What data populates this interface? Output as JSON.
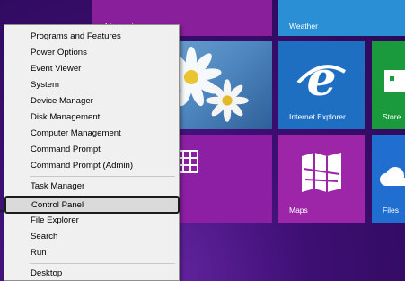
{
  "tiles": {
    "messaging_label": "Messaging",
    "weather_label": "Weather",
    "ie_label": "Internet Explorer",
    "store_label": "Store",
    "maps_label": "Maps",
    "files_label": "Files"
  },
  "menu": {
    "items": [
      "Programs and Features",
      "Power Options",
      "Event Viewer",
      "System",
      "Device Manager",
      "Disk Management",
      "Computer Management",
      "Command Prompt",
      "Command Prompt (Admin)",
      "Task Manager",
      "Control Panel",
      "File Explorer",
      "Search",
      "Run",
      "Desktop"
    ],
    "highlighted": "Control Panel"
  },
  "colors": {
    "start_background": "#3d0f73",
    "weather_tile": "#2b8fd6",
    "ie_tile": "#1e6fc2",
    "store_tile": "#1a9a3c",
    "maps_tile": "#9d26a8",
    "files_tile": "#1f6ed0",
    "messaging_tile": "#8a1f9c",
    "highlight_border": "#1b1b1b"
  }
}
